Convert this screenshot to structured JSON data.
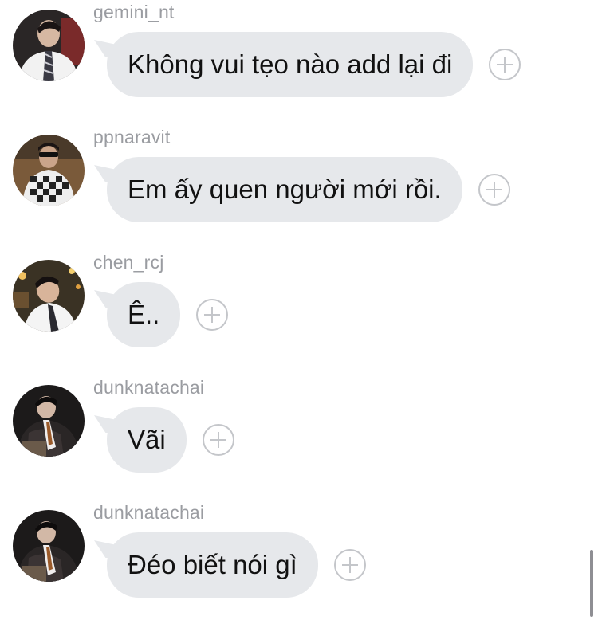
{
  "messages": [
    {
      "username": "gemini_nt",
      "text": "Không vui tẹo nào add lại đi",
      "avatar": "avatar-photo-suit-tie"
    },
    {
      "username": "ppnaravit",
      "text": "Em ấy quen người mới rồi.",
      "avatar": "avatar-photo-checkered-sunglasses"
    },
    {
      "username": "chen_rcj",
      "text": "Ê..",
      "avatar": "avatar-photo-city-night"
    },
    {
      "username": "dunknatachai",
      "text": "Vãi",
      "avatar": "avatar-photo-leather-jacket"
    },
    {
      "username": "dunknatachai",
      "text": "Đéo biết nói gì",
      "avatar": "avatar-photo-leather-jacket"
    }
  ],
  "colors": {
    "bubble": "#e6e8eb",
    "username": "#9a9ca1",
    "text": "#111111",
    "react_icon": "#c4c6ca"
  }
}
